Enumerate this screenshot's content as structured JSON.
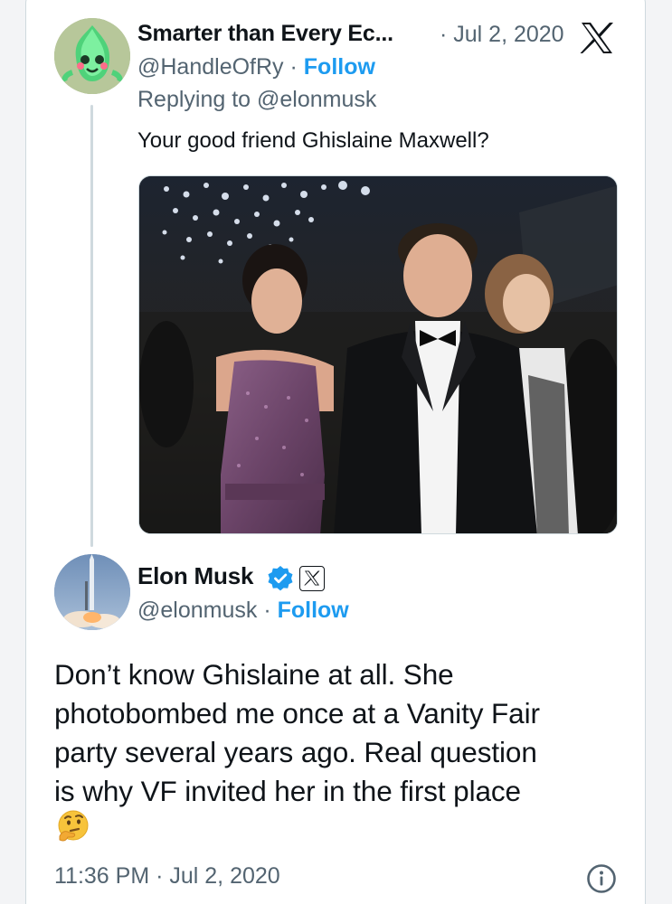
{
  "reply_tweet": {
    "display_name": "Smarter than Every Ec...",
    "date": "· Jul 2, 2020",
    "handle": "@HandleOfRy",
    "separator": " · ",
    "follow_label": "Follow",
    "replying_to": "Replying to @elonmusk",
    "text": "Your good friend Ghislaine Maxwell?"
  },
  "main_tweet": {
    "display_name": "Elon Musk",
    "handle": "@elonmusk",
    "separator": " · ",
    "follow_label": "Follow",
    "text_lines": [
      "Don’t know Ghislaine at all. She",
      "photobombed me once at a Vanity Fair",
      "party several years ago. Real question",
      "is why VF invited her in the first place"
    ],
    "emoji": "thinking-face",
    "timestamp": "11:36 PM · Jul 2, 2020"
  },
  "icons": {
    "platform_logo": "x-logo-icon",
    "verified": "verified-badge-icon",
    "affiliation": "x-affiliation-badge",
    "info": "info-icon"
  },
  "colors": {
    "link_blue": "#1d9bf0",
    "muted_text": "#536471",
    "primary_text": "#0f1419",
    "border": "#cfd9de"
  }
}
